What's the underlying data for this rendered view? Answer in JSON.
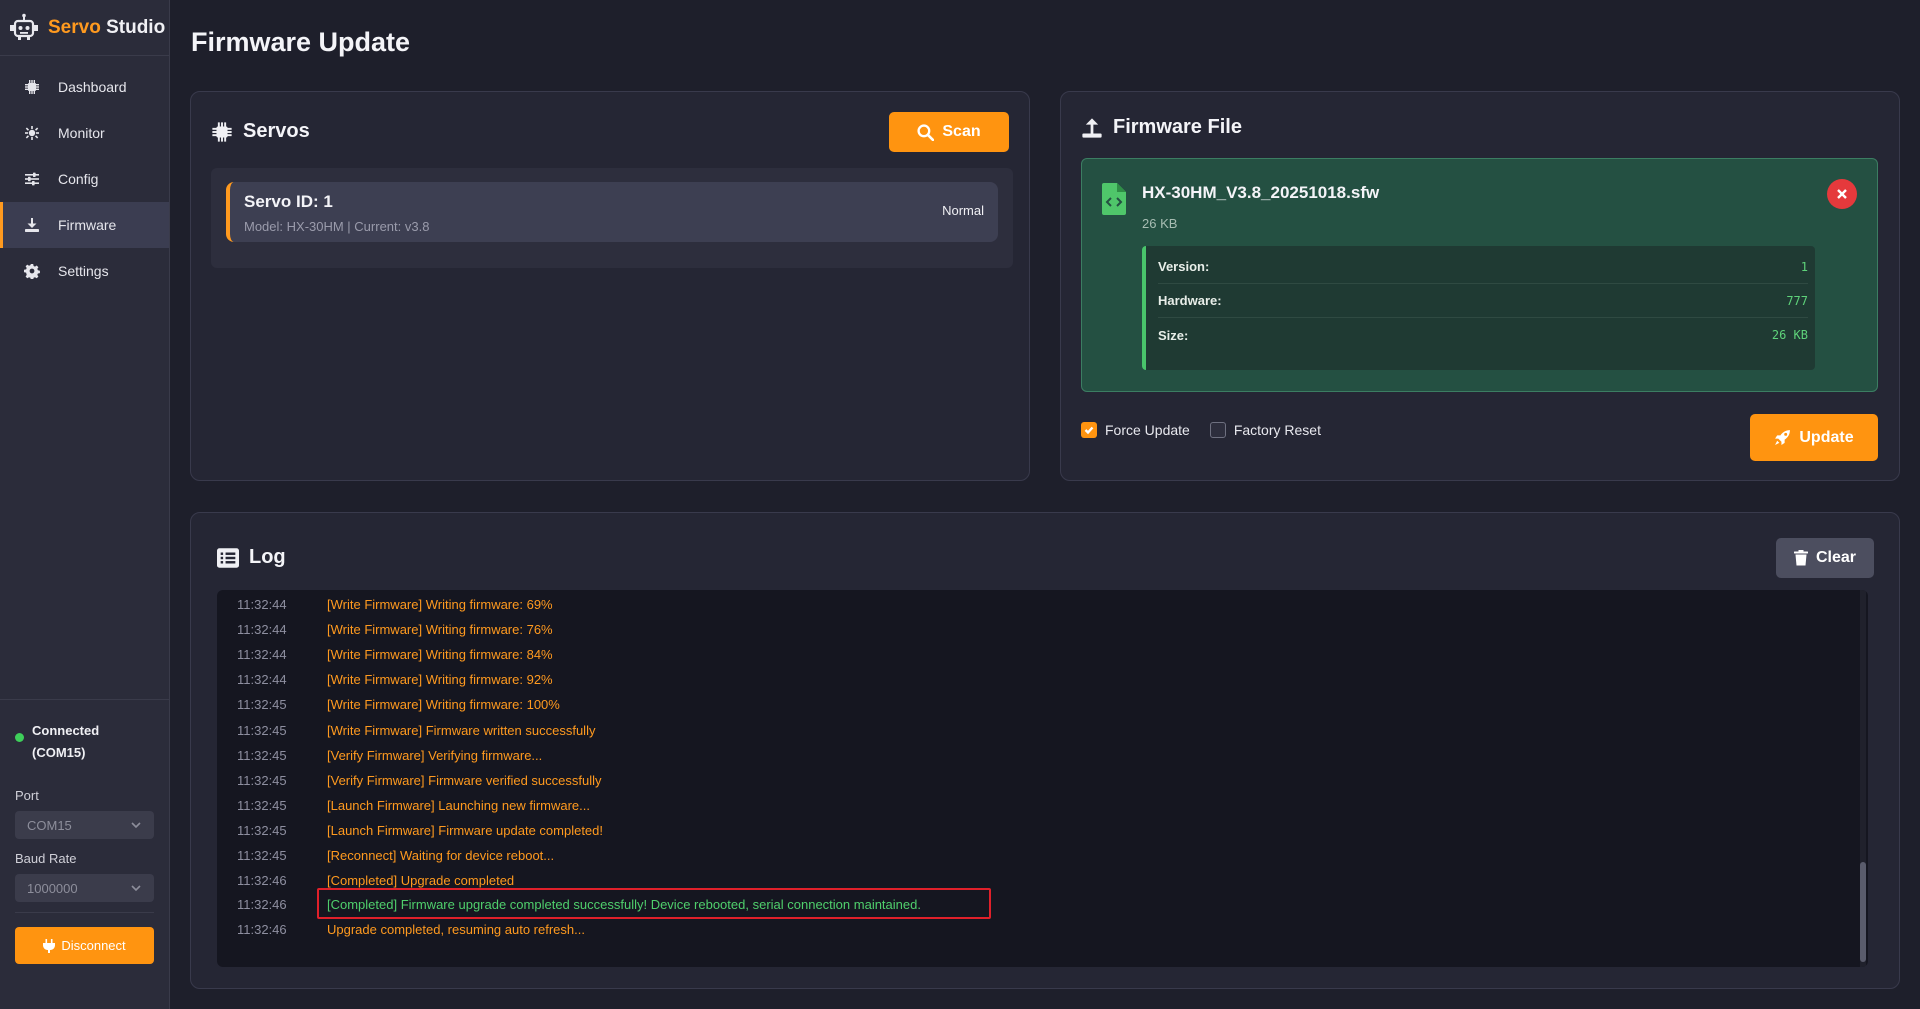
{
  "app": {
    "name_part1": "Servo",
    "name_part2": "Studio",
    "accent": "#ff9a1f"
  },
  "sidebar": {
    "items": [
      {
        "label": "Dashboard",
        "icon": "chip-icon"
      },
      {
        "label": "Monitor",
        "icon": "pulse-icon"
      },
      {
        "label": "Config",
        "icon": "sliders-icon"
      },
      {
        "label": "Firmware",
        "icon": "download-icon",
        "active": true
      },
      {
        "label": "Settings",
        "icon": "gear-icon"
      }
    ],
    "connection": {
      "status": "Connected",
      "port_label": "(COM15)"
    },
    "port_label": "Port",
    "port_value": "COM15",
    "baud_label": "Baud Rate",
    "baud_value": "1000000",
    "disconnect_label": "Disconnect"
  },
  "page": {
    "title": "Firmware Update"
  },
  "servos": {
    "title": "Servos",
    "scan_label": "Scan",
    "items": [
      {
        "id_label": "Servo ID: 1",
        "meta": "Model: HX-30HM | Current: v3.8",
        "status": "Normal"
      }
    ]
  },
  "firmware": {
    "title": "Firmware File",
    "file_name": "HX-30HM_V3.8_20251018.sfw",
    "file_size": "26 KB",
    "details": [
      {
        "key": "Version:",
        "value": "1"
      },
      {
        "key": "Hardware:",
        "value": "777"
      },
      {
        "key": "Size:",
        "value": "26 KB"
      }
    ],
    "force_update_label": "Force Update",
    "force_update_checked": true,
    "factory_reset_label": "Factory Reset",
    "factory_reset_checked": false,
    "update_label": "Update"
  },
  "log": {
    "title": "Log",
    "clear_label": "Clear",
    "entries": [
      {
        "time": "11:32:44",
        "msg": "[Write Firmware] Writing firmware: 69%"
      },
      {
        "time": "11:32:44",
        "msg": "[Write Firmware] Writing firmware: 76%"
      },
      {
        "time": "11:32:44",
        "msg": "[Write Firmware] Writing firmware: 84%"
      },
      {
        "time": "11:32:44",
        "msg": "[Write Firmware] Writing firmware: 92%"
      },
      {
        "time": "11:32:45",
        "msg": "[Write Firmware] Writing firmware: 100%"
      },
      {
        "time": "11:32:45",
        "msg": "[Write Firmware] Firmware written successfully"
      },
      {
        "time": "11:32:45",
        "msg": "[Verify Firmware] Verifying firmware..."
      },
      {
        "time": "11:32:45",
        "msg": "[Verify Firmware] Firmware verified successfully"
      },
      {
        "time": "11:32:45",
        "msg": "[Launch Firmware] Launching new firmware..."
      },
      {
        "time": "11:32:45",
        "msg": "[Launch Firmware] Firmware update completed!"
      },
      {
        "time": "11:32:45",
        "msg": "[Reconnect] Waiting for device reboot..."
      },
      {
        "time": "11:32:46",
        "msg": "[Completed] Upgrade completed"
      },
      {
        "time": "11:32:46",
        "msg": "[Completed] Firmware upgrade completed successfully! Device rebooted, serial connection maintained.",
        "success": true
      },
      {
        "time": "11:32:46",
        "msg": "Upgrade completed, resuming auto refresh..."
      }
    ]
  }
}
